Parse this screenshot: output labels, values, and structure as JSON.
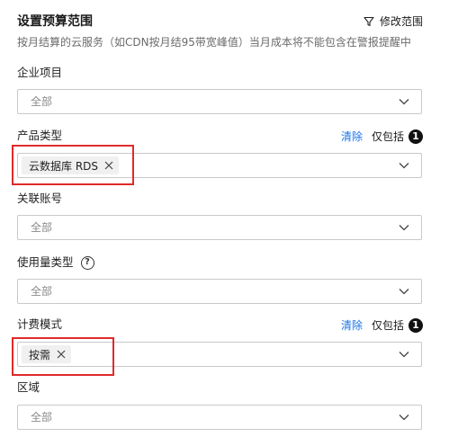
{
  "header": {
    "title": "设置预算范围",
    "edit_label": "修改范围",
    "subtitle": "按月结算的云服务（如CDN按月结95带宽峰值）当月成本将不能包含在警报提醒中"
  },
  "fields": {
    "project": {
      "label": "企业项目",
      "value": "全部"
    },
    "product_type": {
      "label": "产品类型",
      "clear_label": "清除",
      "include_label": "仅包括",
      "count": "1",
      "tag": "云数据库 RDS"
    },
    "account": {
      "label": "关联账号",
      "value": "全部"
    },
    "usage_type": {
      "label": "使用量类型",
      "help": "?",
      "value": "全部"
    },
    "billing_mode": {
      "label": "计费模式",
      "clear_label": "清除",
      "include_label": "仅包括",
      "count": "1",
      "tag": "按需"
    },
    "region": {
      "label": "区域",
      "value": "全部"
    }
  },
  "icons": {
    "filter": "filter-icon",
    "chevron": "chevron-down-icon",
    "close": "close-icon",
    "help": "help-icon"
  },
  "colors": {
    "link": "#1a73e8",
    "highlight": "#e02a2a",
    "badge": "#111111"
  }
}
